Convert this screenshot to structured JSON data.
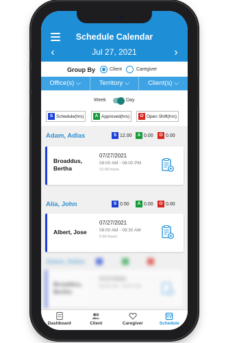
{
  "header": {
    "title": "Schedule Calendar",
    "date": "Jul 27, 2021"
  },
  "group_by": {
    "label": "Group By",
    "options": [
      {
        "label": "Client",
        "selected": true
      },
      {
        "label": "Caregiver",
        "selected": false
      }
    ]
  },
  "filters": [
    "Office(s)",
    "Territory",
    "Client(s)"
  ],
  "view_toggle": {
    "left": "Week",
    "right": "Day",
    "selected": "Day"
  },
  "legend": [
    {
      "code": "S",
      "label": "Schedule(hrs)",
      "color": "#1b3fd6"
    },
    {
      "code": "A",
      "label": "Approved(hrs)",
      "color": "#169a3a"
    },
    {
      "code": "O",
      "label": "Open Shift(hrs)",
      "color": "#d8251d"
    }
  ],
  "groups": [
    {
      "name": "Adam, Adlas",
      "stats": {
        "S": "12.00",
        "A": "0.00",
        "O": "0.00"
      },
      "visit": {
        "caregiver": "Broaddus, Bertha",
        "date": "07/27/2021",
        "time": "08:00 AM - 08:00 PM",
        "hours": "12.00 hours"
      }
    },
    {
      "name": "Alia, John",
      "stats": {
        "S": "0.50",
        "A": "0.00",
        "O": "0.00"
      },
      "visit": {
        "caregiver": "Albert, Jose",
        "date": "07/27/2021",
        "time": "08:00 AM - 08:30 AM",
        "hours": "0.50 hours"
      }
    },
    {
      "name": "Adam, Adlas",
      "stats": {
        "S": "",
        "A": "",
        "O": ""
      },
      "visit": {
        "caregiver": "Broaddus, Bertha",
        "date": "07/27/2021",
        "time": "08:00 AM - 08:00 PM",
        "hours": ""
      }
    }
  ],
  "bottom_nav": [
    {
      "label": "Dashboard",
      "icon": "dashboard-icon"
    },
    {
      "label": "Client",
      "icon": "client-icon"
    },
    {
      "label": "Caregiver",
      "icon": "caregiver-icon"
    },
    {
      "label": "Schedule",
      "icon": "schedule-icon",
      "active": true
    }
  ],
  "colors": {
    "primary": "#1e8fd7",
    "filter_bar": "#3da3e4",
    "toggle": "#1b7f79"
  }
}
